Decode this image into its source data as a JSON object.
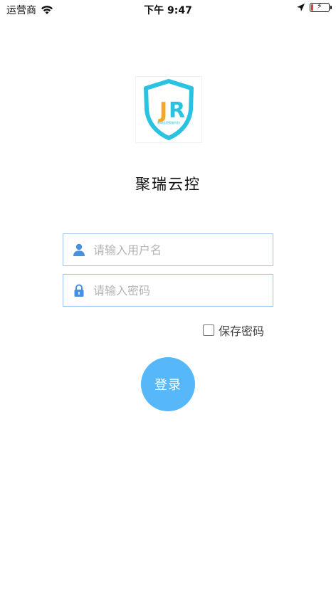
{
  "status_bar": {
    "carrier": "运营商",
    "time": "下午 9:47",
    "battery_level": 0.15,
    "icons": [
      "wifi-icon",
      "location-arrow-icon",
      "battery-charging-icon"
    ]
  },
  "app": {
    "logo_letters": "JR",
    "logo_caption": "聚瑞云控智能科技",
    "title": "聚瑞云控"
  },
  "login": {
    "username_placeholder": "请输入用户名",
    "username_value": "",
    "password_placeholder": "请输入密码",
    "password_value": "",
    "save_password_label": "保存密码",
    "save_password_checked": false,
    "submit_label": "登录"
  },
  "colors": {
    "accent": "#56b8f9",
    "input_border": "#9bc4ee",
    "icon_blue": "#4a90e2",
    "shield_teal": "#29c2e0",
    "logo_orange": "#f5a623",
    "battery_red": "#e63c3c"
  }
}
